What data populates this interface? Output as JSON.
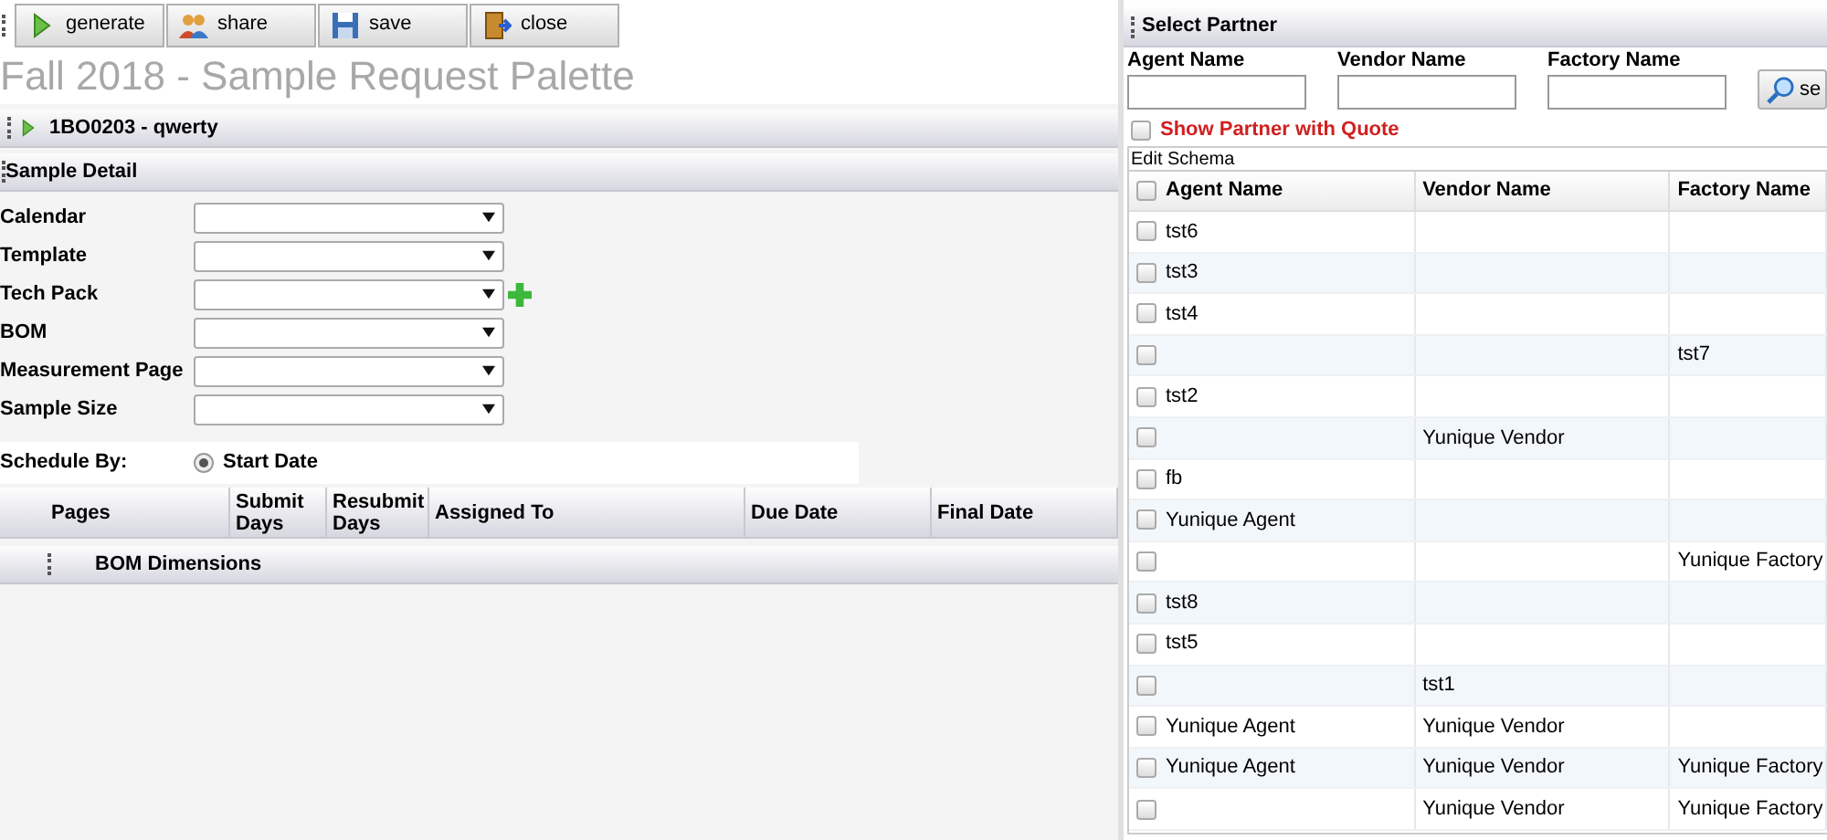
{
  "toolbar": [
    {
      "kind": "play",
      "label": "generate"
    },
    {
      "kind": "people",
      "label": "share"
    },
    {
      "kind": "disk",
      "label": "save"
    },
    {
      "kind": "door",
      "label": "close"
    }
  ],
  "page_title": "Fall 2018 - Sample Request Palette",
  "record": {
    "label": "1BO0203 - qwerty"
  },
  "sample_detail": {
    "title": "Sample Detail",
    "fields": [
      {
        "label": "Calendar",
        "add": false
      },
      {
        "label": "Template",
        "add": false
      },
      {
        "label": "Tech Pack",
        "add": true
      },
      {
        "label": "BOM",
        "add": false
      },
      {
        "label": "Measurement Page",
        "add": false
      },
      {
        "label": "Sample Size",
        "add": false
      }
    ],
    "schedule_by": {
      "label": "Schedule By:",
      "options": [
        {
          "label": "Start Date",
          "selected": true
        }
      ]
    },
    "table": {
      "columns": [
        "Pages",
        "Submit Days",
        "Resubmit Days",
        "Assigned To",
        "Due Date",
        "Final Date"
      ]
    },
    "bom_section": "BOM Dimensions"
  },
  "partner": {
    "title": "Select Partner",
    "filters": [
      {
        "label": "Agent Name"
      },
      {
        "label": "Vendor Name"
      },
      {
        "label": "Factory Name"
      }
    ],
    "search_button": "se",
    "show_with_quote": {
      "label": "Show Partner with Quote",
      "checked": false
    },
    "edit_schema": "Edit Schema",
    "header_checked": false,
    "columns": [
      "Agent Name",
      "Vendor Name",
      "Factory Name"
    ],
    "rows": [
      {
        "agent": "tst6",
        "vendor": "",
        "factory": "",
        "checked": false
      },
      {
        "agent": "tst3",
        "vendor": "",
        "factory": "",
        "checked": false
      },
      {
        "agent": "tst4",
        "vendor": "",
        "factory": "",
        "checked": false
      },
      {
        "agent": "",
        "vendor": "",
        "factory": "tst7",
        "checked": false
      },
      {
        "agent": "tst2",
        "vendor": "",
        "factory": "",
        "checked": false
      },
      {
        "agent": "",
        "vendor": "Yunique Vendor",
        "factory": "",
        "checked": false
      },
      {
        "agent": "fb",
        "vendor": "",
        "factory": "",
        "checked": false
      },
      {
        "agent": "Yunique Agent",
        "vendor": "",
        "factory": "",
        "checked": false
      },
      {
        "agent": "",
        "vendor": "",
        "factory": "Yunique Factory",
        "checked": false
      },
      {
        "agent": "tst8",
        "vendor": "",
        "factory": "",
        "checked": false
      },
      {
        "agent": "tst5",
        "vendor": "",
        "factory": "",
        "checked": false
      },
      {
        "agent": "",
        "vendor": "tst1",
        "factory": "",
        "checked": false
      },
      {
        "agent": "Yunique Agent",
        "vendor": "Yunique Vendor",
        "factory": "",
        "checked": false
      },
      {
        "agent": "Yunique Agent",
        "vendor": "Yunique Vendor",
        "factory": "Yunique Factory",
        "checked": false
      },
      {
        "agent": "",
        "vendor": "Yunique Vendor",
        "factory": "Yunique Factory",
        "checked": false
      }
    ]
  }
}
